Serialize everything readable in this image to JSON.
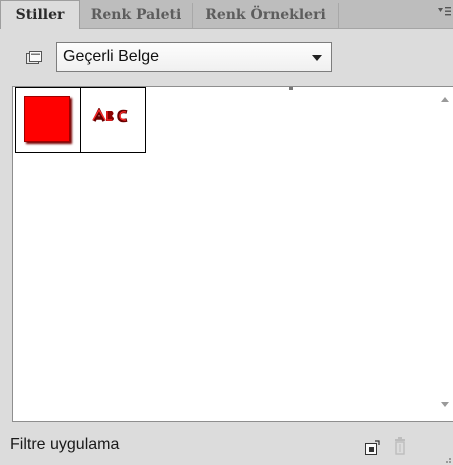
{
  "tabs": [
    {
      "label": "Stiller",
      "active": true
    },
    {
      "label": "Renk Paleti",
      "active": false
    },
    {
      "label": "Renk Örnekleri",
      "active": false
    }
  ],
  "selector": {
    "icon": "document-folder-icon",
    "value": "Geçerli Belge"
  },
  "swatches": [
    {
      "name": "red-square-style",
      "color": "#ff0000"
    },
    {
      "name": "abc-text-style",
      "color": "#c00000"
    }
  ],
  "footer": {
    "label": "Filtre uygulama",
    "new_icon": "new-style-icon",
    "delete_icon": "trash-icon"
  },
  "colors": {
    "panel_bg": "#dcdcdc",
    "tab_bar_bg": "#bdbdbd",
    "accent_red": "#ff0000"
  }
}
